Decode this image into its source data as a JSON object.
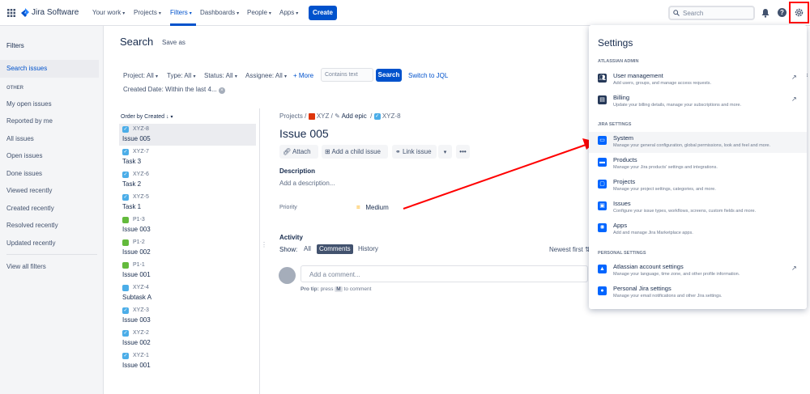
{
  "colors": {
    "brand": "#0052CC",
    "highlight": "#FF0000",
    "background": "#F4F5F7"
  },
  "topbar": {
    "app_name": "Jira Software",
    "nav": [
      "Your work",
      "Projects",
      "Filters",
      "Dashboards",
      "People",
      "Apps"
    ],
    "create_label": "Create",
    "search_placeholder": "Search"
  },
  "sidebar": {
    "title": "Filters",
    "active_item": "Search issues",
    "section_label": "OTHER",
    "items": [
      "My open issues",
      "Reported by me",
      "All issues",
      "Open issues",
      "Done issues",
      "Viewed recently",
      "Created recently",
      "Resolved recently",
      "Updated recently"
    ],
    "view_all": "View all filters"
  },
  "search": {
    "title": "Search",
    "save_as": "Save as",
    "filters": [
      "Project: All",
      "Type: All",
      "Status: All",
      "Assignee: All"
    ],
    "more_label": "+ More",
    "text_placeholder": "Contains text",
    "search_button": "Search",
    "switch_jql": "Switch to JQL",
    "created_date": "Created Date: Within the last 4..."
  },
  "issue_list": {
    "order_label": "Order by Created",
    "items": [
      {
        "key": "XYZ-8",
        "summary": "Issue 005",
        "type": "task"
      },
      {
        "key": "XYZ-7",
        "summary": "Task 3",
        "type": "task"
      },
      {
        "key": "XYZ-6",
        "summary": "Task 2",
        "type": "task"
      },
      {
        "key": "XYZ-5",
        "summary": "Task 1",
        "type": "task"
      },
      {
        "key": "P1-3",
        "summary": "Issue 003",
        "type": "story"
      },
      {
        "key": "P1-2",
        "summary": "Issue 002",
        "type": "story"
      },
      {
        "key": "P1-1",
        "summary": "Issue 001",
        "type": "story"
      },
      {
        "key": "XYZ-4",
        "summary": "Subtask A",
        "type": "subtask"
      },
      {
        "key": "XYZ-3",
        "summary": "Issue 003",
        "type": "task"
      },
      {
        "key": "XYZ-2",
        "summary": "Issue 002",
        "type": "task"
      },
      {
        "key": "XYZ-1",
        "summary": "Issue 001",
        "type": "task"
      }
    ]
  },
  "issue": {
    "breadcrumb_projects": "Projects",
    "breadcrumb_project": "XYZ",
    "add_epic": "Add epic",
    "breadcrumb_key": "XYZ-8",
    "title": "Issue 005",
    "attach": "Attach",
    "add_child": "Add a child issue",
    "link_issue": "Link issue",
    "description_label": "Description",
    "description_placeholder": "Add a description...",
    "priority_label": "Priority",
    "priority_value": "Medium",
    "activity_label": "Activity",
    "show_label": "Show:",
    "tabs": [
      "All",
      "Comments",
      "History"
    ],
    "sort_label": "Newest first",
    "comment_placeholder": "Add a comment...",
    "pro_tip": "Pro tip:",
    "pro_tip_rest": "press",
    "pro_tip_key": "M",
    "pro_tip_end": "to comment"
  },
  "settings_panel": {
    "title": "Settings",
    "sections": [
      {
        "label": "ATLASSIAN ADMIN",
        "items": [
          {
            "name": "User management",
            "desc": "Add users, groups, and manage access requests.",
            "icon": "users-icon",
            "external": true
          },
          {
            "name": "Billing",
            "desc": "Update your billing details, manage your subscriptions and more.",
            "icon": "billing-icon",
            "external": true
          }
        ]
      },
      {
        "label": "JIRA SETTINGS",
        "items": [
          {
            "name": "System",
            "desc": "Manage your general configuration, global permissions, look and feel and more.",
            "icon": "system-icon",
            "external": false
          },
          {
            "name": "Products",
            "desc": "Manage your Jira products' settings and integrations.",
            "icon": "products-icon",
            "external": false
          },
          {
            "name": "Projects",
            "desc": "Manage your project settings, categories, and more.",
            "icon": "projects-icon",
            "external": false
          },
          {
            "name": "Issues",
            "desc": "Configure your issue types, workflows, screens, custom fields and more.",
            "icon": "issues-icon",
            "external": false
          },
          {
            "name": "Apps",
            "desc": "Add and manage Jira Marketplace apps.",
            "icon": "apps-icon",
            "external": false
          }
        ]
      },
      {
        "label": "PERSONAL SETTINGS",
        "items": [
          {
            "name": "Atlassian account settings",
            "desc": "Manage your language, time zone, and other profile information.",
            "icon": "atlassian-icon",
            "external": true
          },
          {
            "name": "Personal Jira settings",
            "desc": "Manage your email notifications and other Jira settings.",
            "icon": "person-icon",
            "external": false
          }
        ]
      }
    ]
  }
}
